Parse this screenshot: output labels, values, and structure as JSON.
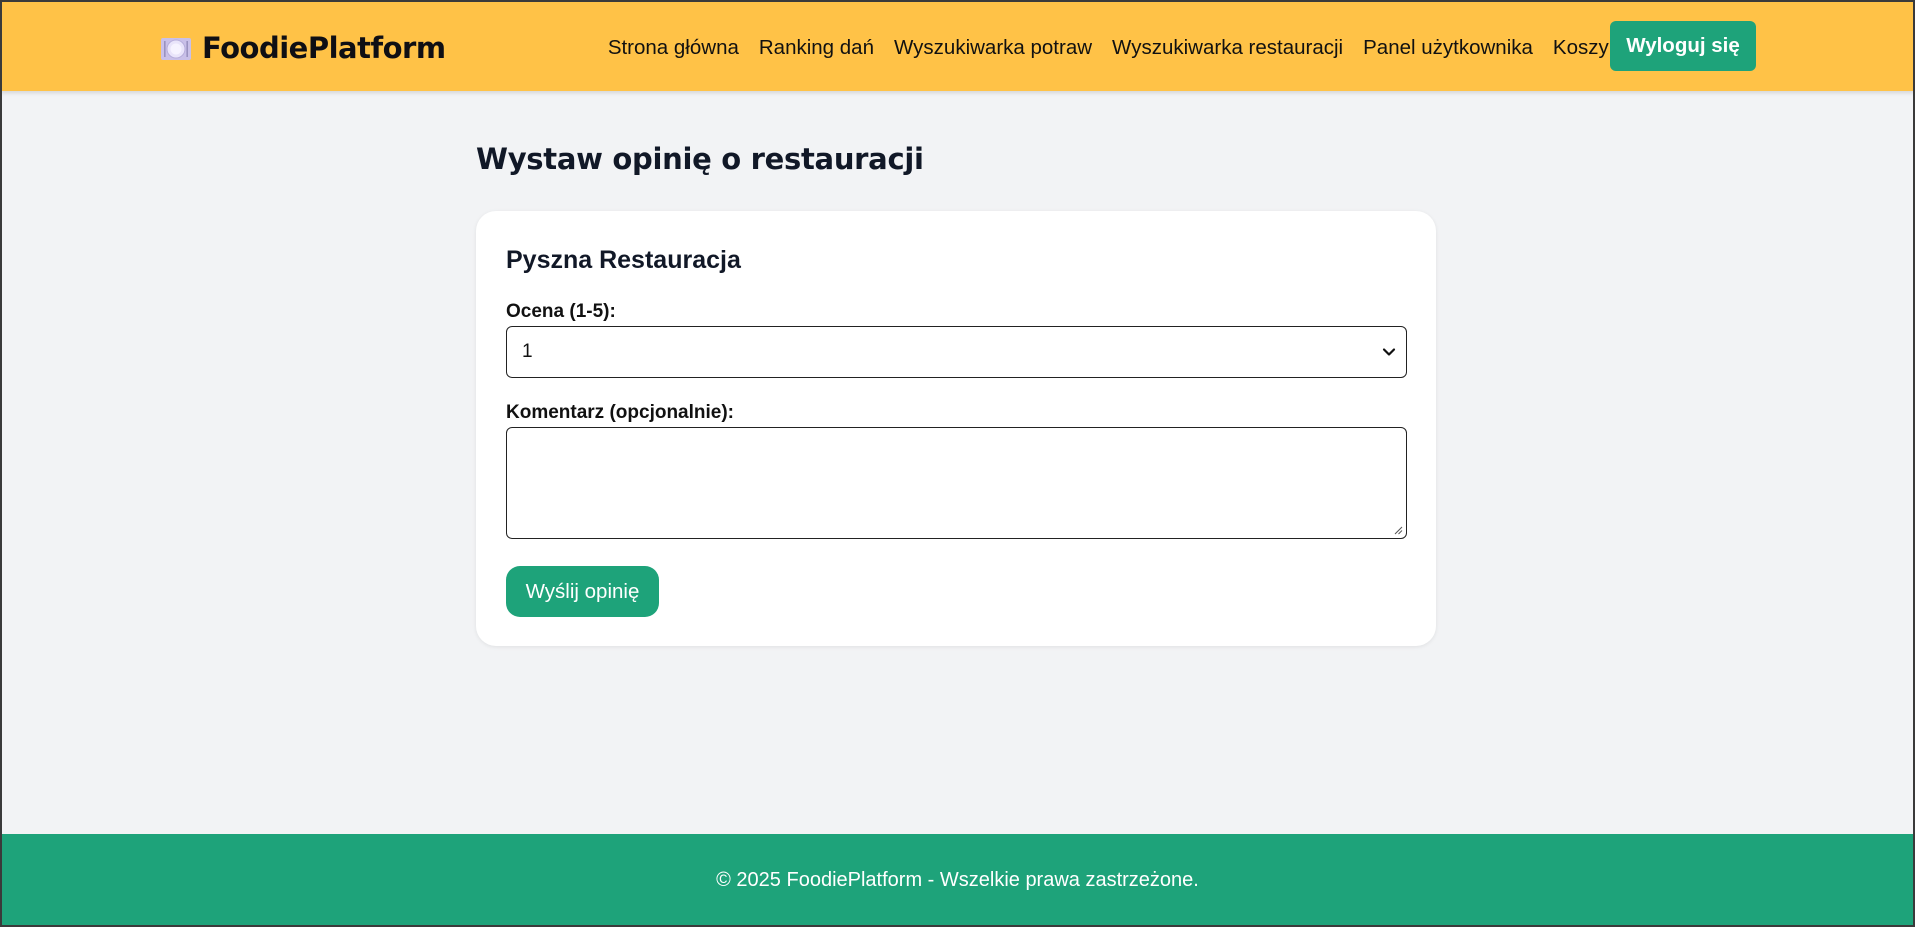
{
  "colors": {
    "header_bg": "#ffc247",
    "accent": "#1ea37a",
    "page_bg": "#f2f3f5",
    "card_bg": "#ffffff"
  },
  "header": {
    "brand_icon": "plate-icon",
    "brand_name": "FoodiePlatform",
    "nav": [
      {
        "label": "Strona główna"
      },
      {
        "label": "Ranking dań"
      },
      {
        "label": "Wyszukiwarka potraw"
      },
      {
        "label": "Wyszukiwarka restauracji"
      },
      {
        "label": "Panel użytkownika"
      },
      {
        "label": "Koszyk"
      }
    ],
    "logout_label": "Wyloguj się"
  },
  "main": {
    "title": "Wystaw opinię o restauracji",
    "form": {
      "restaurant_name": "Pyszna Restauracja",
      "rating_label": "Ocena (1-5):",
      "rating_value": "1",
      "rating_icon": "chevron-down-icon",
      "comment_label": "Komentarz (opcjonalnie):",
      "comment_value": "",
      "submit_label": "Wyślij opinię"
    }
  },
  "footer": {
    "text": "© 2025 FoodiePlatform - Wszelkie prawa zastrzeżone."
  }
}
